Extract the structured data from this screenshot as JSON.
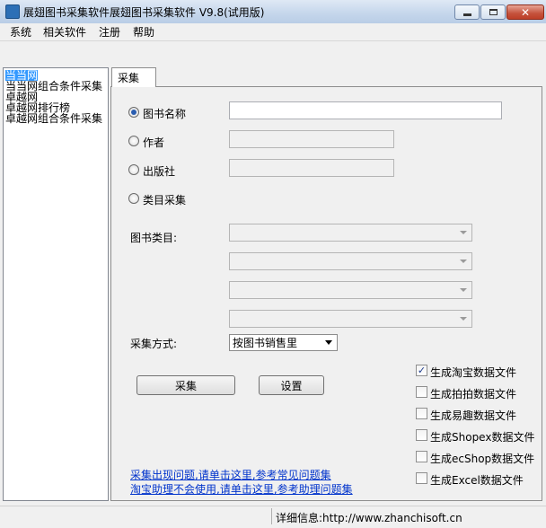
{
  "window": {
    "title": "展翅图书采集软件展翅图书采集软件 V9.8(试用版)",
    "close_symbol": "✕"
  },
  "menu": [
    "系统",
    "相关软件",
    "注册",
    "帮助"
  ],
  "tree": {
    "items": [
      "当当网",
      "当当网组合条件采集",
      "卓越网",
      "卓越网排行榜",
      "卓越网组合条件采集"
    ],
    "selected_index": 0
  },
  "tab": {
    "label": "采集"
  },
  "form": {
    "radios": [
      {
        "label": "图书名称",
        "checked": true
      },
      {
        "label": "作者",
        "checked": false
      },
      {
        "label": "出版社",
        "checked": false
      },
      {
        "label": "类目采集",
        "checked": false
      }
    ],
    "category_label": "图书类目:",
    "mode_label": "采集方式:",
    "mode_value": "按图书销售里",
    "collect_button": "采集",
    "settings_button": "设置"
  },
  "checkboxes": [
    {
      "label": "生成淘宝数据文件",
      "checked": true
    },
    {
      "label": "生成拍拍数据文件",
      "checked": false
    },
    {
      "label": "生成易趣数据文件",
      "checked": false
    },
    {
      "label": "生成Shopex数据文件",
      "checked": false
    },
    {
      "label": "生成ecShop数据文件",
      "checked": false
    },
    {
      "label": "生成Excel数据文件",
      "checked": false
    }
  ],
  "check_mark": "✓",
  "links": [
    "采集出现问题,请单击这里,参考常见问题集",
    "淘宝助理不会使用,请单击这里,参考助理问题集"
  ],
  "status": {
    "text": "详细信息:http://www.zhanchisoft.cn"
  }
}
